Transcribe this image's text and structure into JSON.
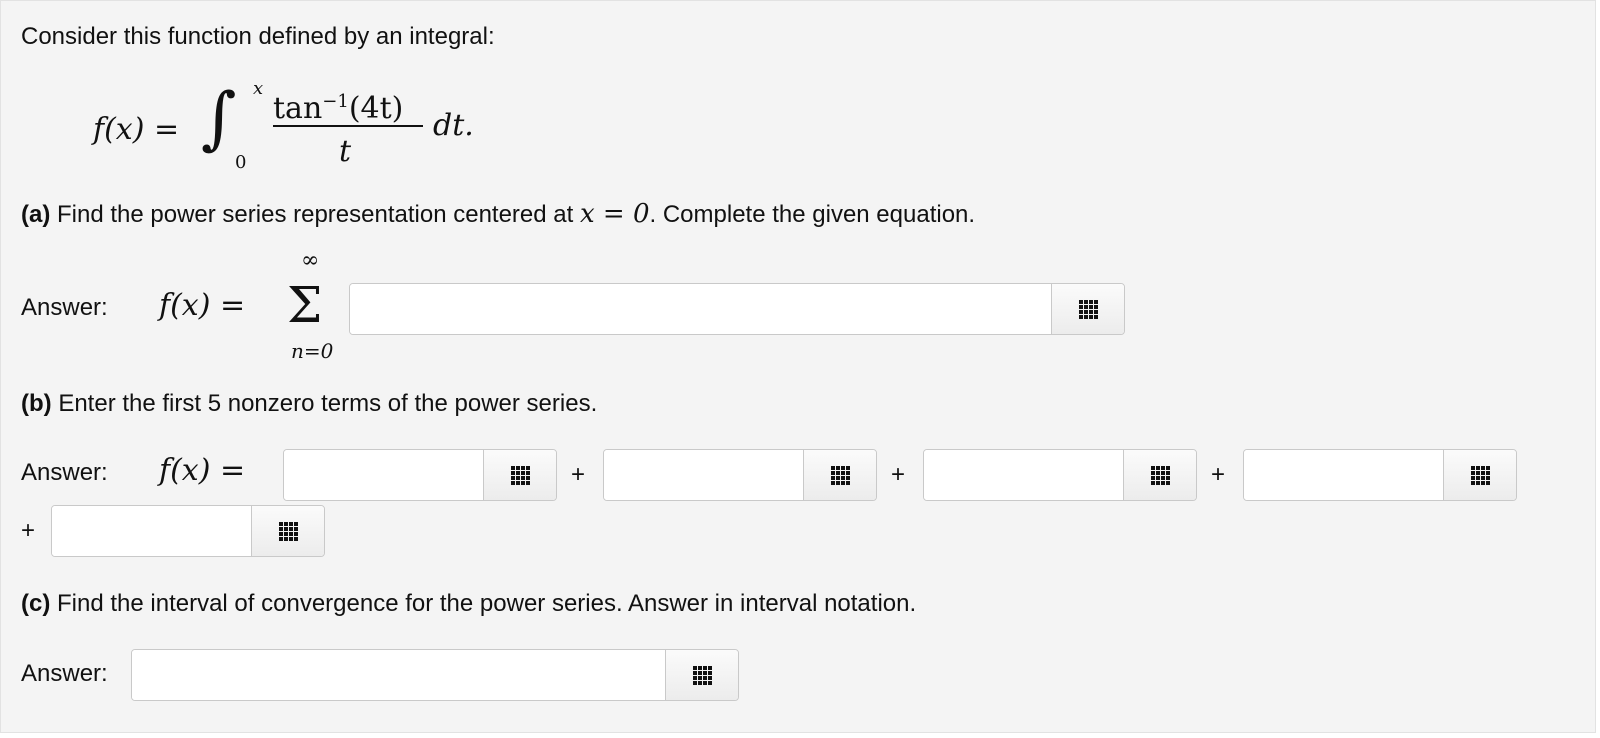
{
  "intro": "Consider this function defined by an integral:",
  "integral": {
    "lhs": "f(x) =",
    "upper": "x",
    "lower": "0",
    "numerator": "tan",
    "numerator_sup": "−1",
    "numerator_arg": "(4t)",
    "denominator": "t",
    "dt": "dt."
  },
  "part_a": {
    "label": "(a)",
    "text_before": " Find the power series representation centered at ",
    "math": "x = 0",
    "text_after": ". Complete the given equation.",
    "answer_label": "Answer:",
    "lhs": "f(x) =",
    "sum_top": "∞",
    "sum_symbol": "Σ",
    "sum_bottom": "n=0",
    "input_value": ""
  },
  "part_b": {
    "label": "(b)",
    "text": " Enter the first 5 nonzero terms of the power series.",
    "answer_label": "Answer:",
    "lhs": "f(x) =",
    "plus": "+",
    "inputs": [
      "",
      "",
      "",
      "",
      ""
    ]
  },
  "part_c": {
    "label": "(c)",
    "text": " Find the interval of convergence for the power series. Answer in interval notation.",
    "answer_label": "Answer:",
    "input_value": ""
  },
  "icons": {
    "keypad": "keypad-grid-icon"
  }
}
